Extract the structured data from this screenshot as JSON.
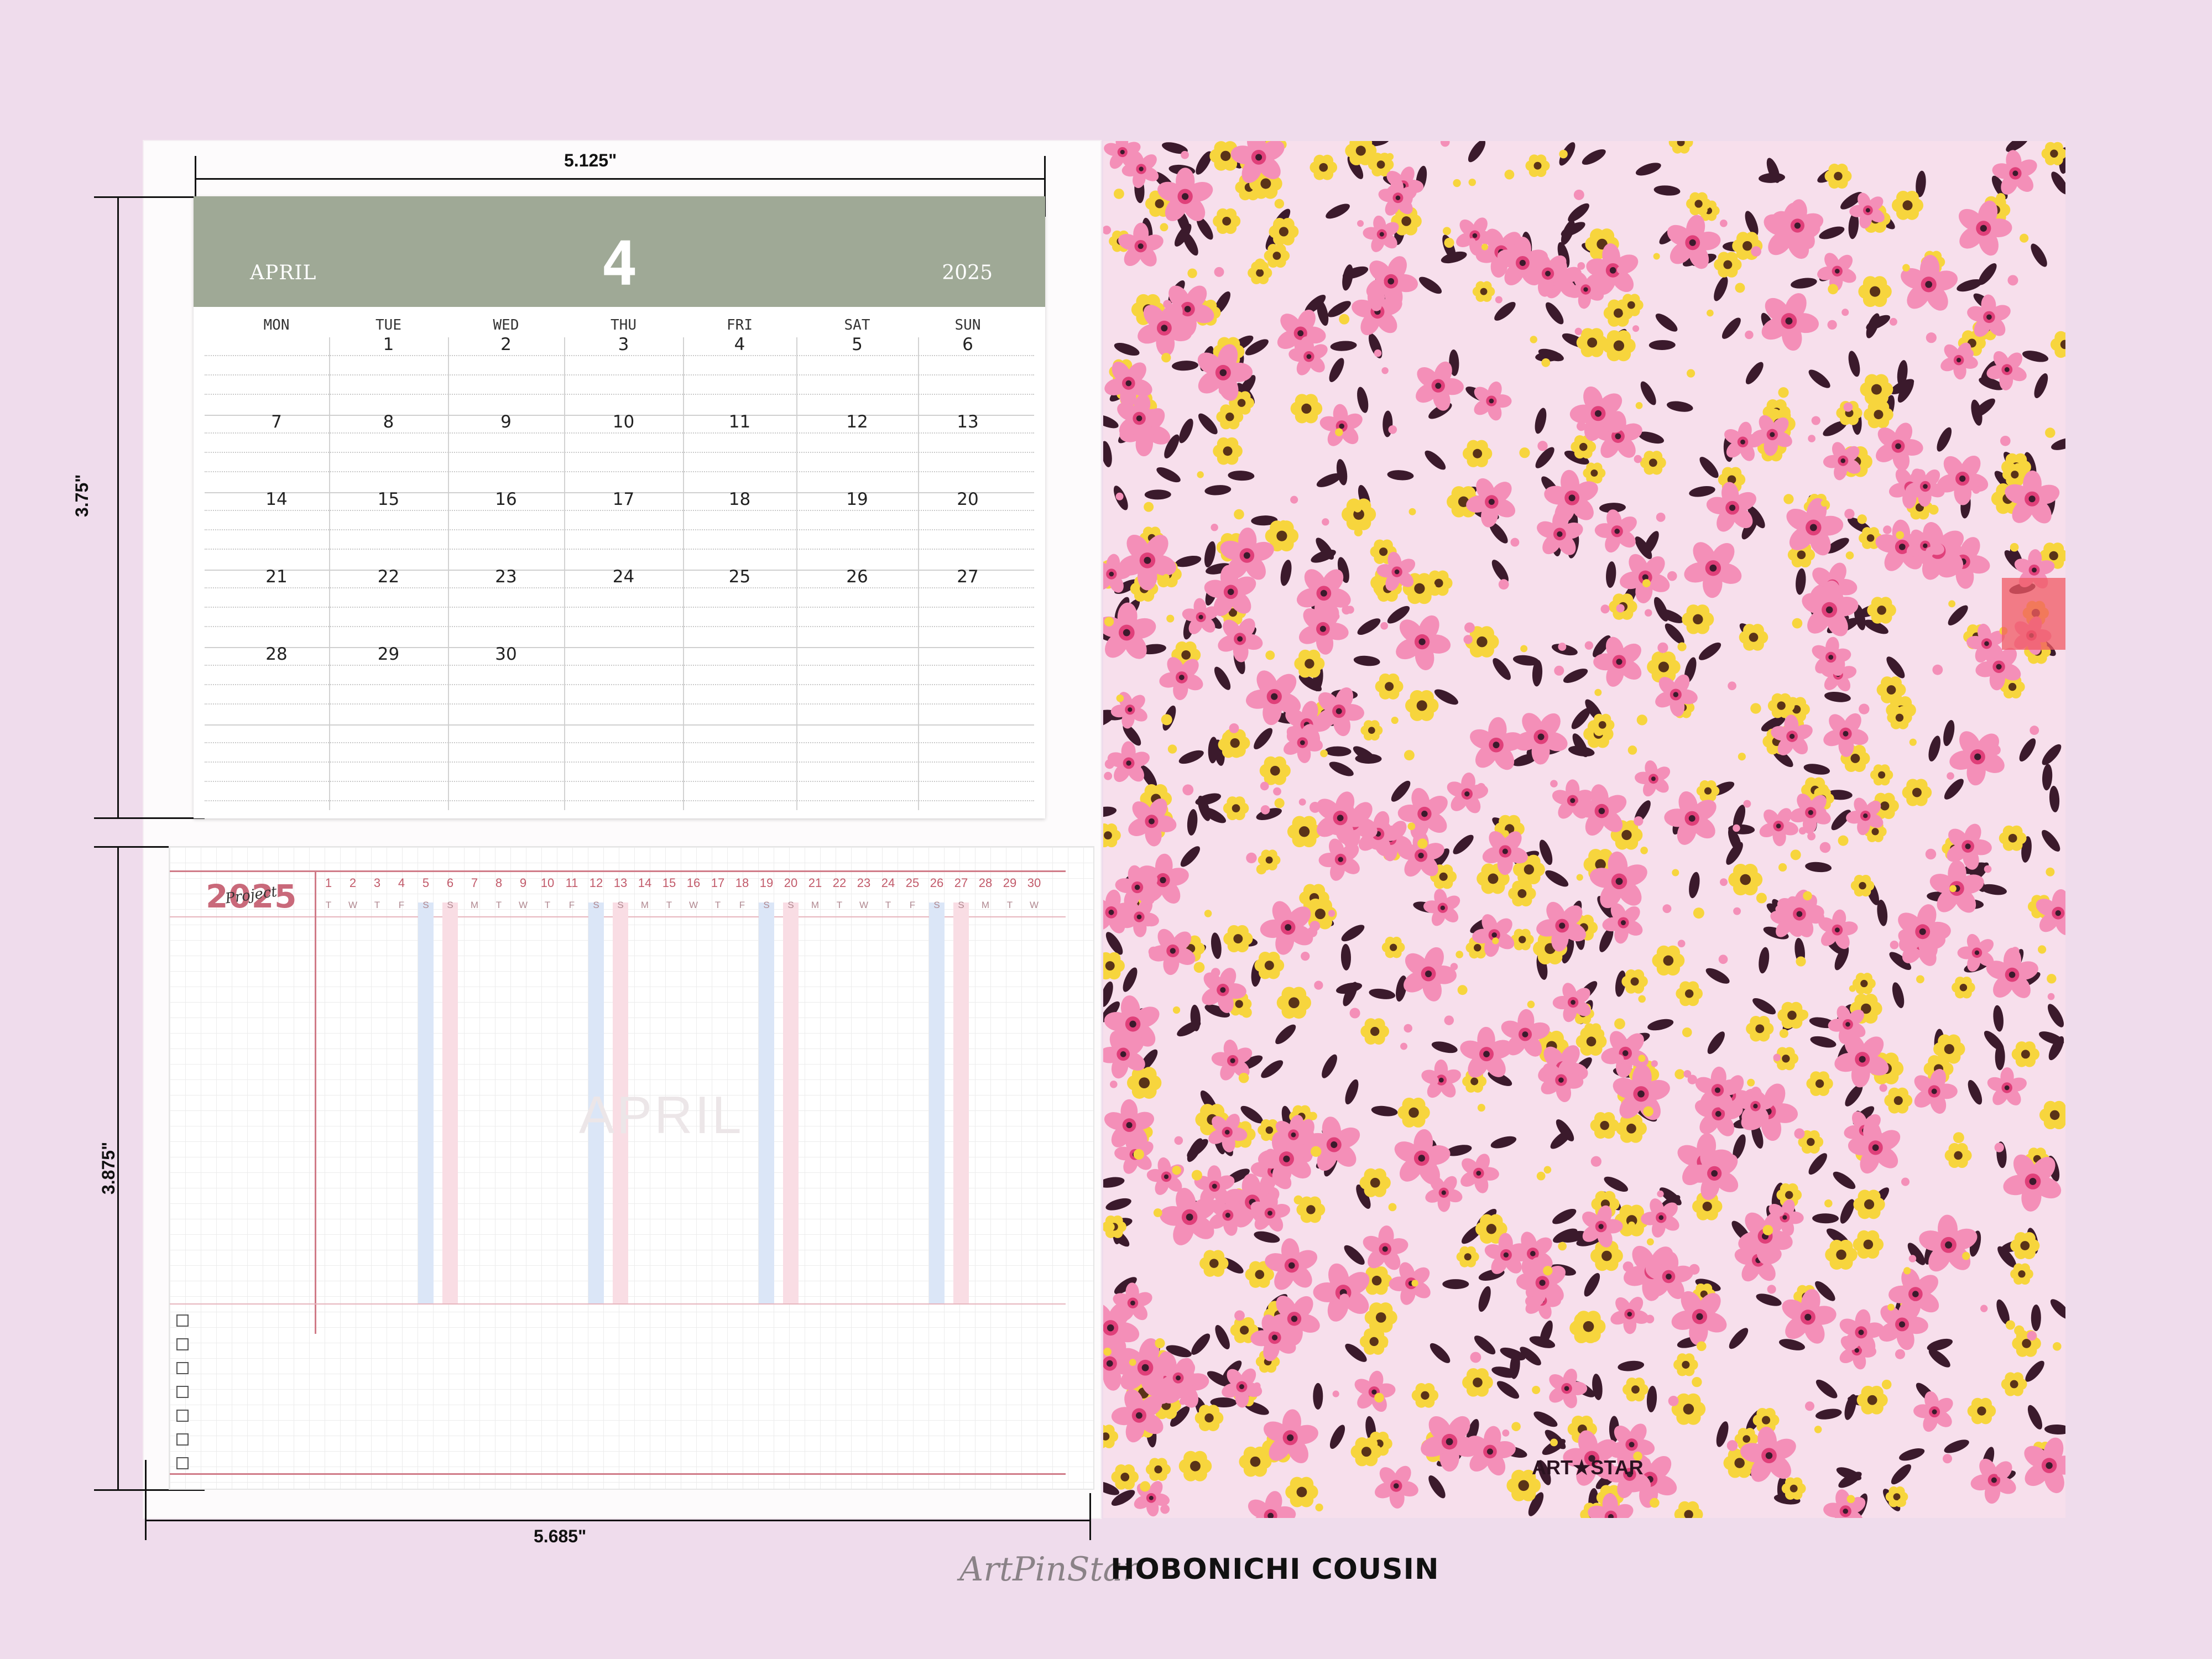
{
  "dimensions": {
    "top_width": "5.125\"",
    "top_height": "3.75\"",
    "bottom_height": "3.875\"",
    "bottom_width": "5.685\""
  },
  "calendar": {
    "month_name": "APRIL",
    "month_number": "4",
    "year": "2025",
    "weekdays": [
      "MON",
      "TUE",
      "WED",
      "THU",
      "FRI",
      "SAT",
      "SUN"
    ],
    "weeks": [
      [
        "",
        "1",
        "2",
        "3",
        "4",
        "5",
        "6"
      ],
      [
        "7",
        "8",
        "9",
        "10",
        "11",
        "12",
        "13"
      ],
      [
        "14",
        "15",
        "16",
        "17",
        "18",
        "19",
        "20"
      ],
      [
        "21",
        "22",
        "23",
        "24",
        "25",
        "26",
        "27"
      ],
      [
        "28",
        "29",
        "30",
        "",
        "",
        "",
        ""
      ]
    ]
  },
  "project": {
    "year": "2025",
    "script_label": "Project",
    "watermark": "APRIL",
    "days": [
      "1",
      "2",
      "3",
      "4",
      "5",
      "6",
      "7",
      "8",
      "9",
      "10",
      "11",
      "12",
      "13",
      "14",
      "15",
      "16",
      "17",
      "18",
      "19",
      "20",
      "21",
      "22",
      "23",
      "24",
      "25",
      "26",
      "27",
      "28",
      "29",
      "30"
    ],
    "day_letters": [
      "T",
      "W",
      "T",
      "F",
      "S",
      "S",
      "M",
      "T",
      "W",
      "T",
      "F",
      "S",
      "S",
      "M",
      "T",
      "W",
      "T",
      "F",
      "S",
      "S",
      "M",
      "T",
      "W",
      "T",
      "F",
      "S",
      "S",
      "M",
      "T",
      "W"
    ],
    "checkbox_count": 7,
    "saturday_color": "#dbe6f7",
    "sunday_color": "#f9dde4"
  },
  "floral_page": {
    "brand_mark": "ART★STAR",
    "palette": {
      "background": "#f7dfec",
      "pink_flower": "#f48fb8",
      "yellow_flower": "#f7d53d",
      "leaf": "#3b1a2c",
      "tab": "#f0646e"
    }
  },
  "footer": {
    "brand_script": "ArtPinStar",
    "product": "HOBONICHI COUSIN"
  }
}
